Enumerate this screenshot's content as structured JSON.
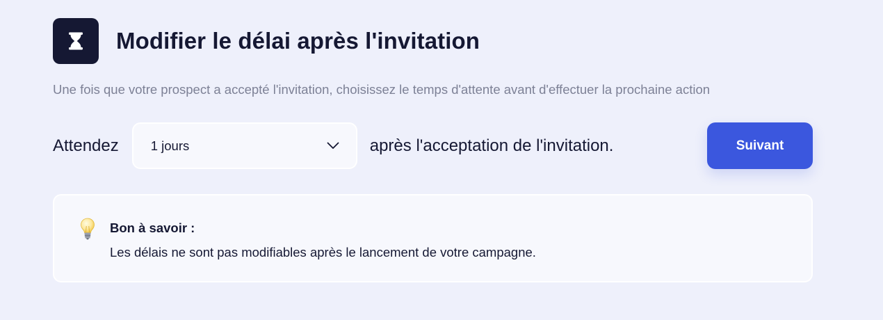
{
  "header": {
    "icon": "hourglass-icon",
    "title": "Modifier le délai après l'invitation"
  },
  "subtitle": "Une fois que votre prospect a accepté l'invitation, choisissez le temps d'attente avant d'effectuer la prochaine action",
  "delay_row": {
    "prefix": "Attendez",
    "select_value": "1 jours",
    "select_icon": "chevron-down-icon",
    "suffix": "après l'acceptation de l'invitation."
  },
  "next_button": {
    "label": "Suivant",
    "color": "#3b57de"
  },
  "info": {
    "icon": "lightbulb-icon",
    "title": "Bon à savoir :",
    "text": "Les délais ne sont pas modifiables après le lancement de votre campagne."
  },
  "colors": {
    "background": "#eef0fb",
    "dark": "#151833",
    "muted": "#7d8196",
    "panel": "#f7f8fd"
  }
}
